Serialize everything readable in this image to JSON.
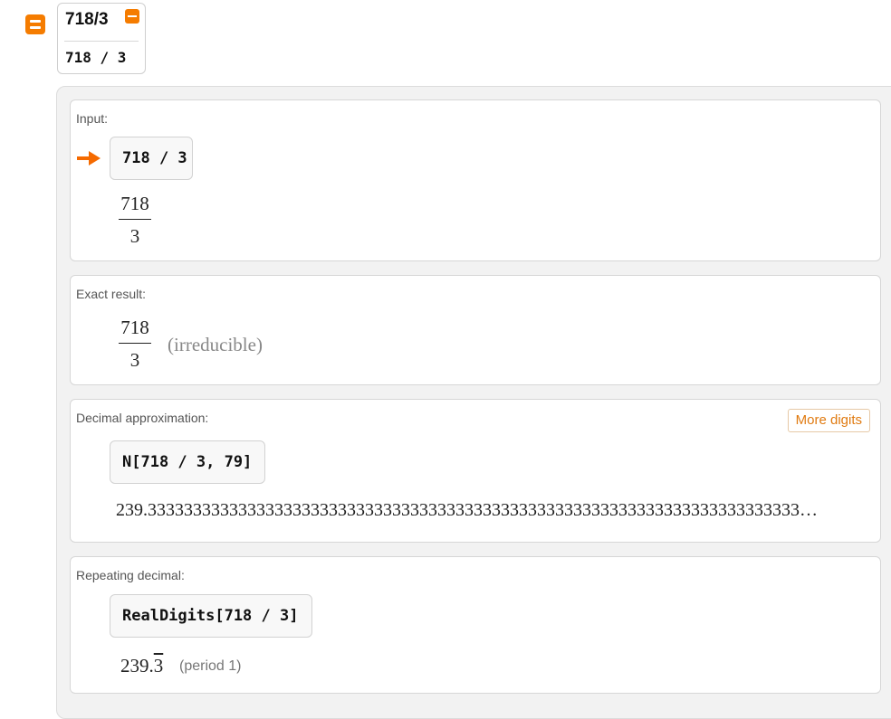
{
  "query": {
    "title": "718/3",
    "code": "718 / 3"
  },
  "pods": {
    "input": {
      "title": "Input:",
      "code": "718 / 3",
      "numerator": "718",
      "denominator": "3"
    },
    "exact": {
      "title": "Exact result:",
      "numerator": "718",
      "denominator": "3",
      "note": "(irreducible)"
    },
    "decimal": {
      "title": "Decimal approximation:",
      "more_digits_label": "More digits",
      "code": "N[718 / 3, 79]",
      "value": "239.333333333333333333333333333333333333333333333333333333333333333333333333…"
    },
    "repeating": {
      "title": "Repeating decimal:",
      "code": "RealDigits[718 / 3]",
      "value_prefix": "239.",
      "value_repeat": "3",
      "period_label": "(period",
      "period_value": "1)"
    }
  },
  "colors": {
    "accent": "#f57c00",
    "arrow": "#f56a00",
    "more_digits_text": "#e07a10"
  },
  "icons": [
    "collapse-toggle-icon",
    "remove-query-icon",
    "input-arrow-icon"
  ]
}
